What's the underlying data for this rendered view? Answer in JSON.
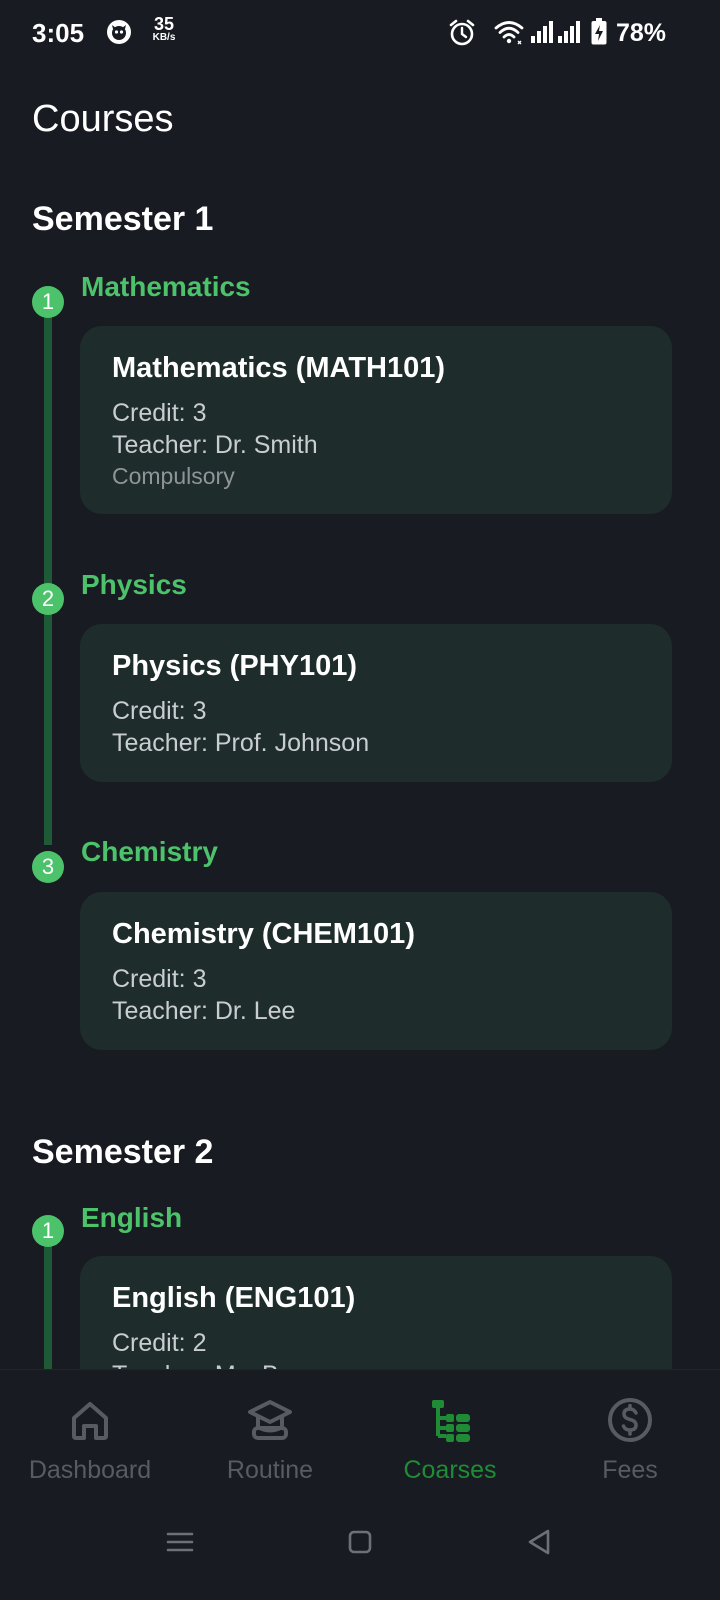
{
  "status_bar": {
    "time": "3:05",
    "speed_value": "35",
    "speed_unit": "KB/s",
    "battery_percent": "78%",
    "icons": [
      "app-notification-icon",
      "alarm-icon",
      "wifi-icon",
      "signal-icon",
      "signal-icon",
      "battery-charging-icon"
    ]
  },
  "page": {
    "title": "Courses"
  },
  "semesters": [
    {
      "title": "Semester 1",
      "courses": [
        {
          "number": "1",
          "name": "Mathematics",
          "card_title": "Mathematics (MATH101)",
          "credit": "Credit: 3",
          "teacher": "Teacher: Dr. Smith",
          "type": "Compulsory"
        },
        {
          "number": "2",
          "name": "Physics",
          "card_title": "Physics (PHY101)",
          "credit": "Credit: 3",
          "teacher": "Teacher: Prof. Johnson"
        },
        {
          "number": "3",
          "name": "Chemistry",
          "card_title": "Chemistry (CHEM101)",
          "credit": "Credit: 3",
          "teacher": "Teacher: Dr. Lee"
        }
      ]
    },
    {
      "title": "Semester 2",
      "courses": [
        {
          "number": "1",
          "name": "English",
          "card_title": "English (ENG101)",
          "credit": "Credit: 2",
          "teacher": "Teacher: Ms. Brown"
        }
      ]
    }
  ],
  "bottom_nav": {
    "items": [
      {
        "label": "Dashboard",
        "icon": "home-icon",
        "active": false
      },
      {
        "label": "Routine",
        "icon": "graduation-cap-icon",
        "active": false
      },
      {
        "label": "Coarses",
        "icon": "tree-list-icon",
        "active": true
      },
      {
        "label": "Fees",
        "icon": "dollar-circle-icon",
        "active": false
      }
    ]
  },
  "colors": {
    "background": "#181b22",
    "accent_green": "#4cc36a",
    "nav_active": "#1f8c35",
    "card": "#1e2d2b",
    "timeline": "#1f5a37"
  }
}
